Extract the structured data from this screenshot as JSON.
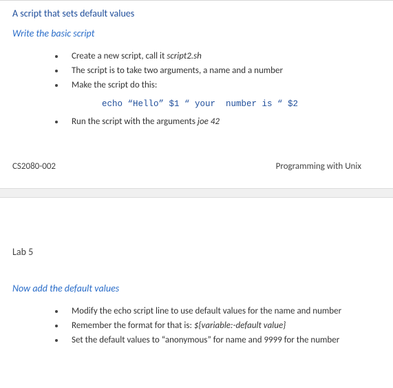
{
  "slide1": {
    "heading": "A script that sets default values",
    "subheading": "Write the basic script",
    "bullets_a": [
      {
        "pre": "Create a new script, call it ",
        "italic": "script2.sh",
        "post": ""
      },
      {
        "pre": "The script is to take two arguments, a name  and a number",
        "italic": "",
        "post": ""
      },
      {
        "pre": "Make the script do this:",
        "italic": "",
        "post": ""
      }
    ],
    "code": "echo “Hello” $1 “ your  number is “ $2",
    "bullets_b": [
      {
        "pre": "Run the script  with the arguments ",
        "italic": "joe  42",
        "post": ""
      }
    ],
    "footer_left": "CS2080-002",
    "footer_right": "Programming with Unix"
  },
  "slide2": {
    "lab_label": "Lab 5",
    "subheading": "Now add the default values",
    "bullets": [
      {
        "pre": "Modify the echo script line to use default values for the name and number",
        "italic": "",
        "post": ""
      },
      {
        "pre": "Remember the format for that is: ",
        "italic": "${variable:-default value}",
        "post": ""
      },
      {
        "pre": "Set the default values to “anonymous” for name and 9999 for the number",
        "italic": "",
        "post": ""
      }
    ]
  }
}
